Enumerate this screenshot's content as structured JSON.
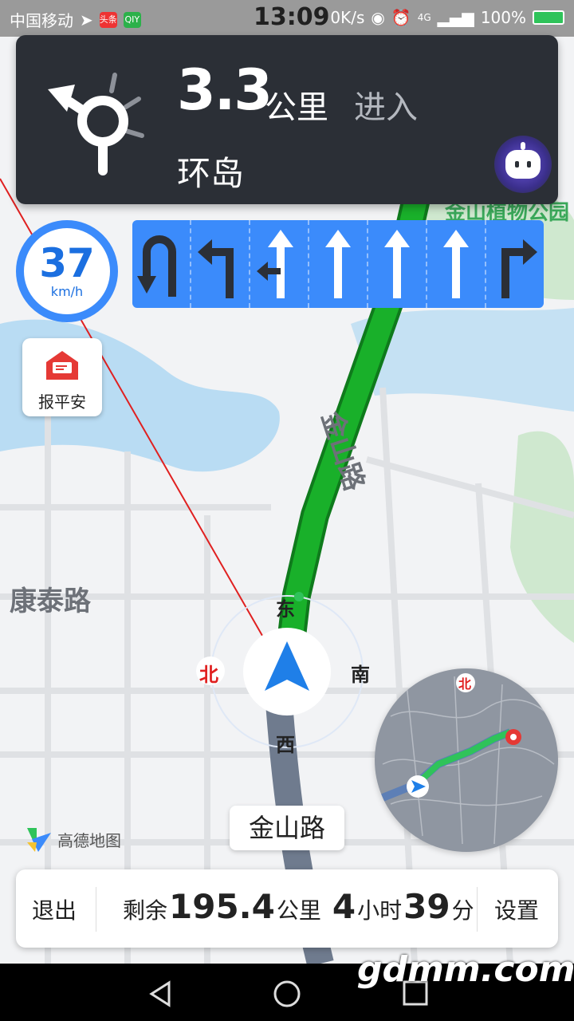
{
  "status_bar": {
    "carrier": "中国移动",
    "time": "13:09",
    "network_speed": "0K/s",
    "signal": "4G",
    "battery": "100%",
    "apps": [
      "头条",
      "QIY"
    ]
  },
  "nav_card": {
    "distance": "3.3",
    "unit": "公里",
    "action": "进入",
    "road": "环岛"
  },
  "speed": {
    "value": "37",
    "unit": "km/h"
  },
  "safe_button": {
    "label": "报平安"
  },
  "lanes": [
    "u-turn",
    "left",
    "left-straight",
    "straight",
    "straight",
    "straight",
    "right"
  ],
  "map": {
    "road_labels": {
      "main": "金山路",
      "cross": "康泰路",
      "poi": "金山植物公园"
    },
    "compass": {
      "east": "东",
      "west": "西",
      "north": "北",
      "south": "南"
    }
  },
  "current_road": "金山路",
  "logo": {
    "text": "高德地图"
  },
  "overview_map": {
    "north": "北"
  },
  "bottom_bar": {
    "exit": "退出",
    "remain_label": "剩余",
    "remain_distance": "195.4",
    "remain_unit": "公里",
    "hours": "4",
    "hours_unit": "小时",
    "minutes": "39",
    "minutes_unit": "分",
    "settings": "设置"
  },
  "watermark": "gdmm.com",
  "colors": {
    "route": "#19b02a",
    "accent": "#3b8bfb",
    "nav_bg": "#2b2f36"
  }
}
